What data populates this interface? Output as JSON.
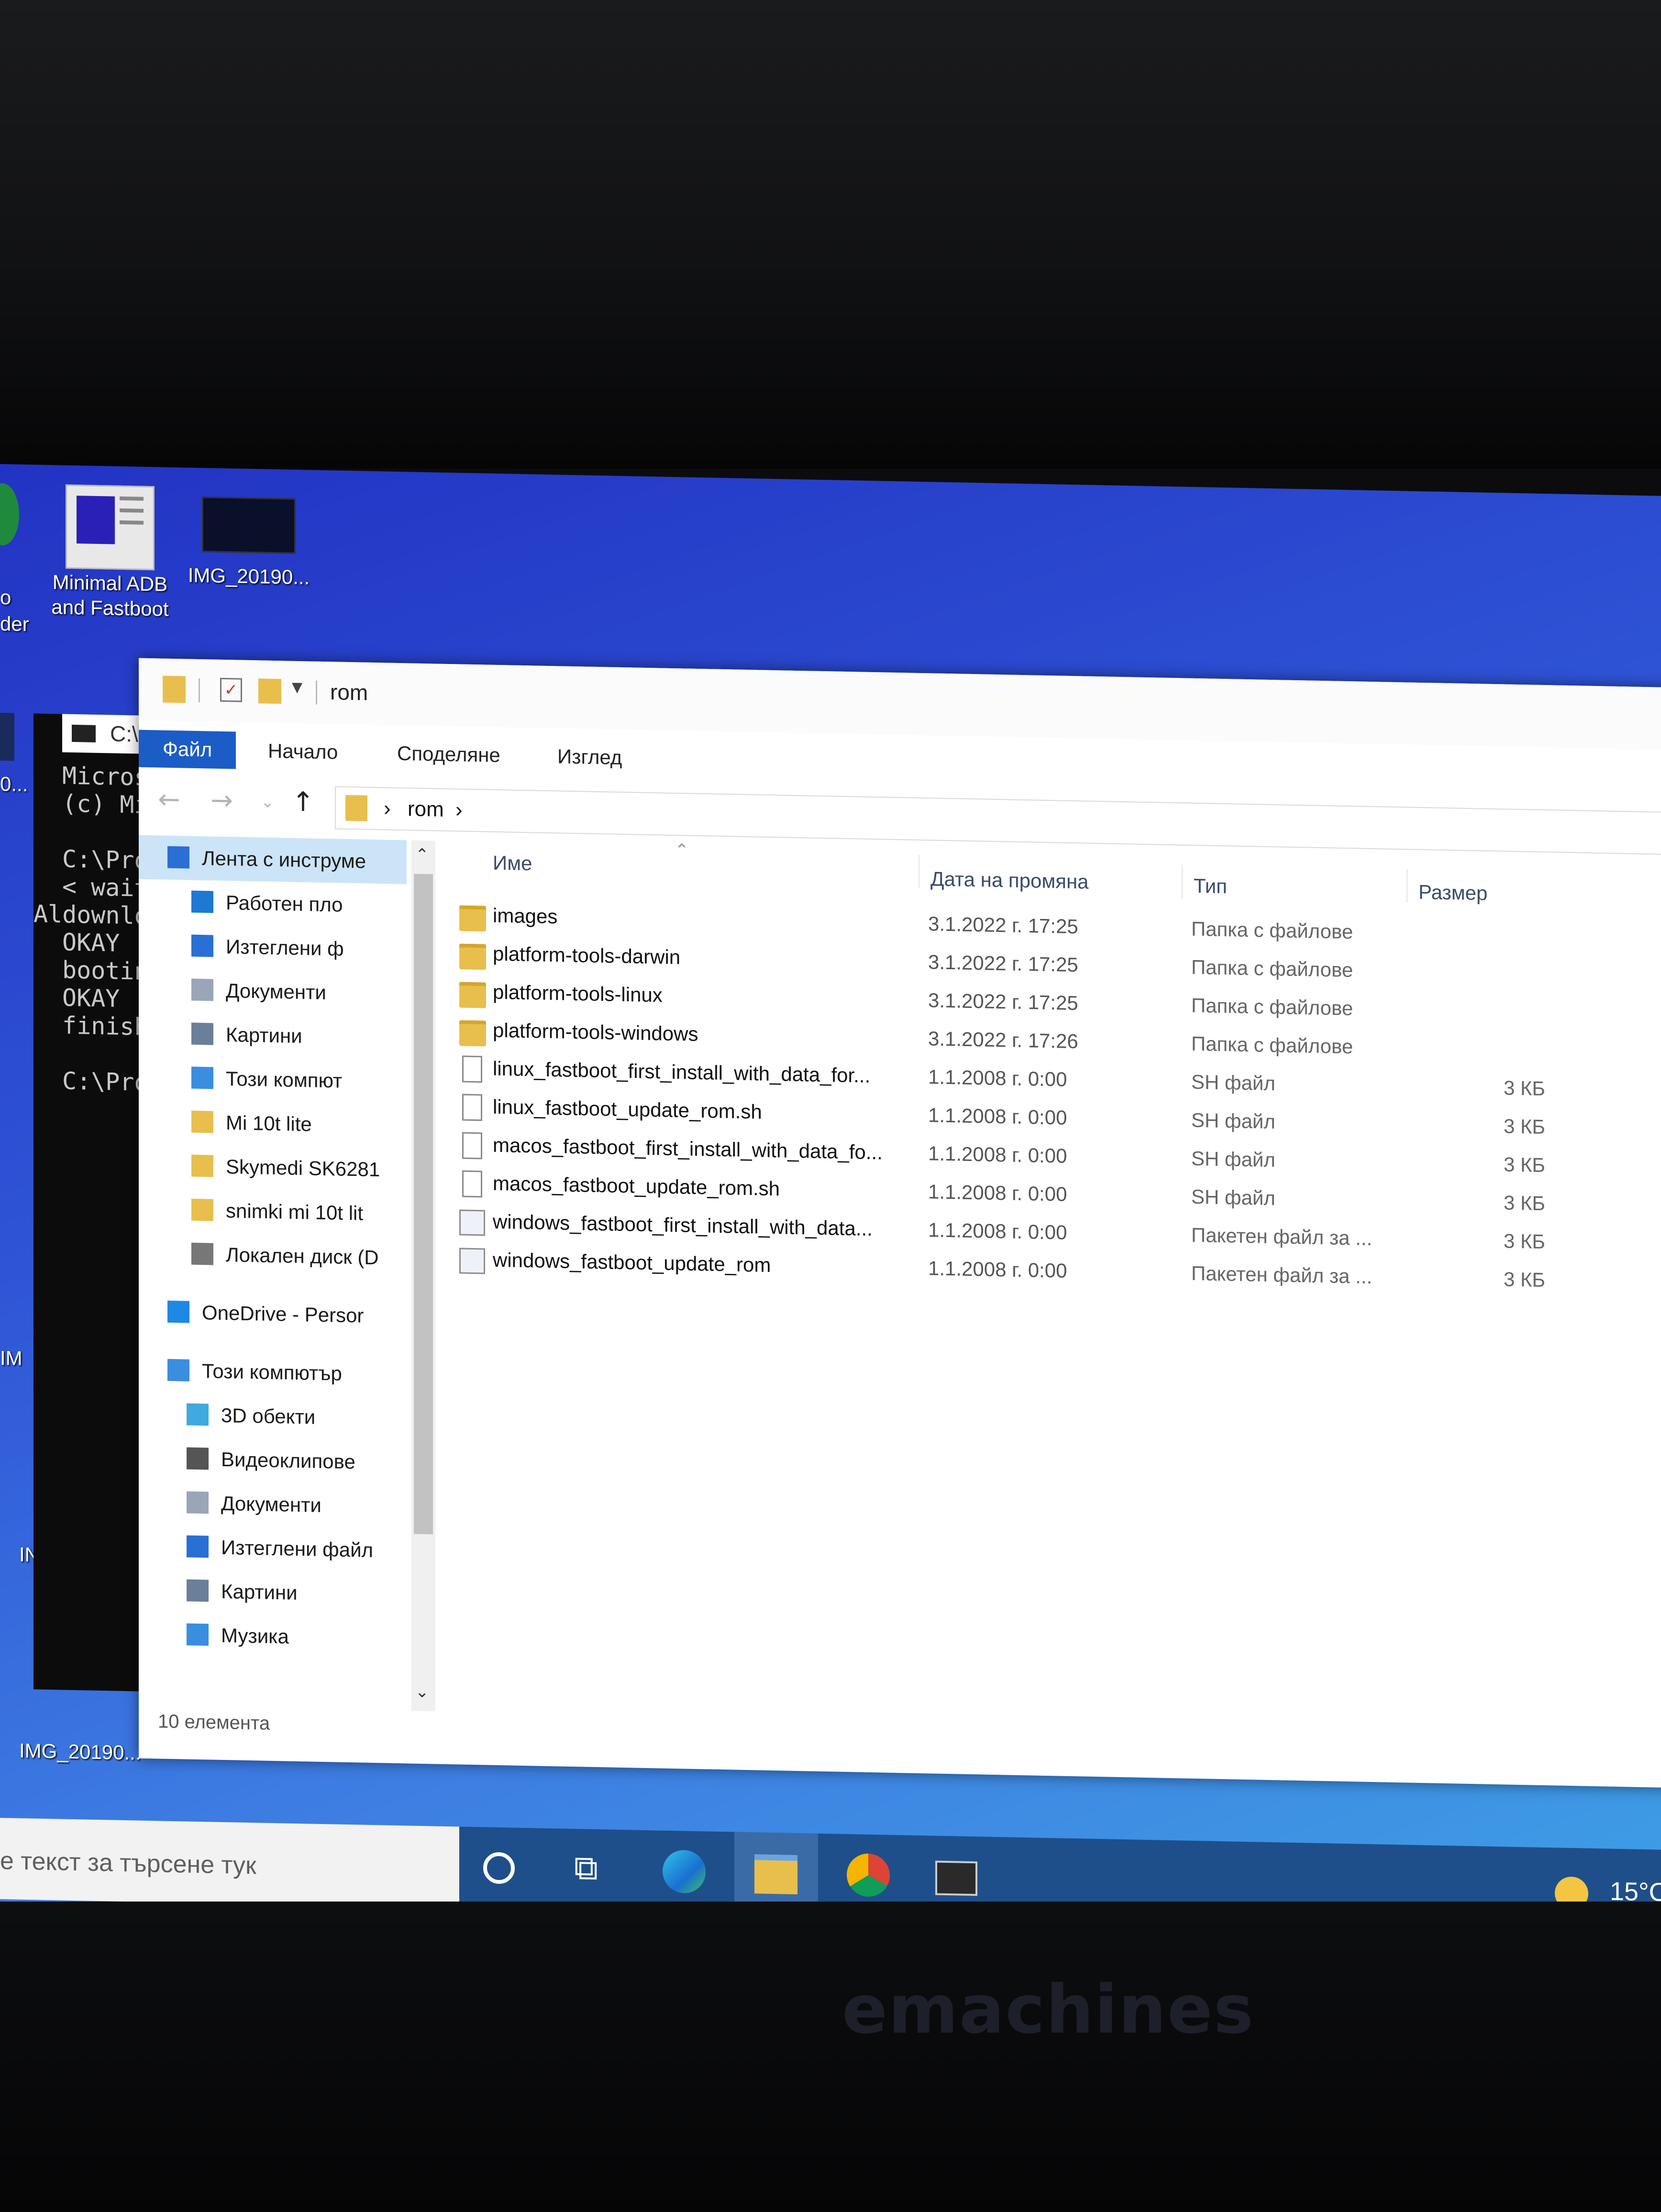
{
  "desktop": {
    "icons": [
      {
        "label_line1": "Minimal ADB",
        "label_line2": "and Fastboot"
      },
      {
        "label_line1": "IMG_20190..."
      },
      {
        "label_line1": "IMG_20190..."
      }
    ],
    "left_partial": [
      "o",
      "der",
      "0...",
      "IN",
      "IM",
      "IN"
    ]
  },
  "cmd": {
    "title": "C:\\V",
    "lines": [
      "Micros",
      "(c) Mi",
      "",
      "C:\\Pro",
      "< wait",
      "Aldownlo",
      "OKAY [",
      "bootin",
      "OKAY [",
      "finish",
      "",
      "C:\\Pro"
    ]
  },
  "explorer": {
    "title": "rom",
    "tabs": {
      "file": "Файл",
      "home": "Начало",
      "share": "Споделяне",
      "view": "Изглед"
    },
    "breadcrumb": [
      "rom"
    ],
    "columns": {
      "name": "Име",
      "date": "Дата на промяна",
      "type": "Тип",
      "size": "Размер"
    },
    "nav": [
      {
        "label": "Лента с инструме",
        "icon": "pin-icon",
        "selected": true
      },
      {
        "label": "Работен пло",
        "icon": "desktop-icon"
      },
      {
        "label": "Изтеглени ф",
        "icon": "download-icon"
      },
      {
        "label": "Документи",
        "icon": "documents-icon"
      },
      {
        "label": "Картини",
        "icon": "pictures-icon"
      },
      {
        "label": "Този компют",
        "icon": "computer-icon"
      },
      {
        "label": "Mi 10t lite",
        "icon": "folder-icon"
      },
      {
        "label": "Skymedi SK6281",
        "icon": "folder-icon"
      },
      {
        "label": "snimki mi 10t lit",
        "icon": "folder-icon"
      },
      {
        "label": "Локален диск (D",
        "icon": "drive-icon"
      },
      {
        "label": "OneDrive - Persor",
        "icon": "onedrive-icon"
      },
      {
        "label": "Този компютър",
        "icon": "computer-icon"
      },
      {
        "label": "3D обекти",
        "icon": "3d-objects-icon"
      },
      {
        "label": "Видеоклипове",
        "icon": "videos-icon"
      },
      {
        "label": "Документи",
        "icon": "documents-icon"
      },
      {
        "label": "Изтеглени файл",
        "icon": "download-icon"
      },
      {
        "label": "Картини",
        "icon": "pictures-icon"
      },
      {
        "label": "Музика",
        "icon": "music-icon"
      }
    ],
    "files": [
      {
        "name": "images",
        "date": "3.1.2022 г. 17:25",
        "type": "Папка с файлове",
        "size": "",
        "kind": "folder"
      },
      {
        "name": "platform-tools-darwin",
        "date": "3.1.2022 г. 17:25",
        "type": "Папка с файлове",
        "size": "",
        "kind": "folder"
      },
      {
        "name": "platform-tools-linux",
        "date": "3.1.2022 г. 17:25",
        "type": "Папка с файлове",
        "size": "",
        "kind": "folder"
      },
      {
        "name": "platform-tools-windows",
        "date": "3.1.2022 г. 17:26",
        "type": "Папка с файлове",
        "size": "",
        "kind": "folder"
      },
      {
        "name": "linux_fastboot_first_install_with_data_for...",
        "date": "1.1.2008 г. 0:00",
        "type": "SH файл",
        "size": "3 КБ",
        "kind": "file"
      },
      {
        "name": "linux_fastboot_update_rom.sh",
        "date": "1.1.2008 г. 0:00",
        "type": "SH файл",
        "size": "3 КБ",
        "kind": "file"
      },
      {
        "name": "macos_fastboot_first_install_with_data_fo...",
        "date": "1.1.2008 г. 0:00",
        "type": "SH файл",
        "size": "3 КБ",
        "kind": "file"
      },
      {
        "name": "macos_fastboot_update_rom.sh",
        "date": "1.1.2008 г. 0:00",
        "type": "SH файл",
        "size": "3 КБ",
        "kind": "file"
      },
      {
        "name": "windows_fastboot_first_install_with_data...",
        "date": "1.1.2008 г. 0:00",
        "type": "Пакетен файл за ...",
        "size": "3 КБ",
        "kind": "batch"
      },
      {
        "name": "windows_fastboot_update_rom",
        "date": "1.1.2008 г. 0:00",
        "type": "Пакетен файл за ...",
        "size": "3 КБ",
        "kind": "batch"
      }
    ],
    "status": "10 елемента"
  },
  "taskbar": {
    "search_placeholder": "е текст за търсене тук",
    "weather": "15°C"
  },
  "brand": "emachines",
  "colors": {
    "accent": "#1b5cc6",
    "folder": "#e8bf4d",
    "taskbar": "#1e4f8a"
  }
}
